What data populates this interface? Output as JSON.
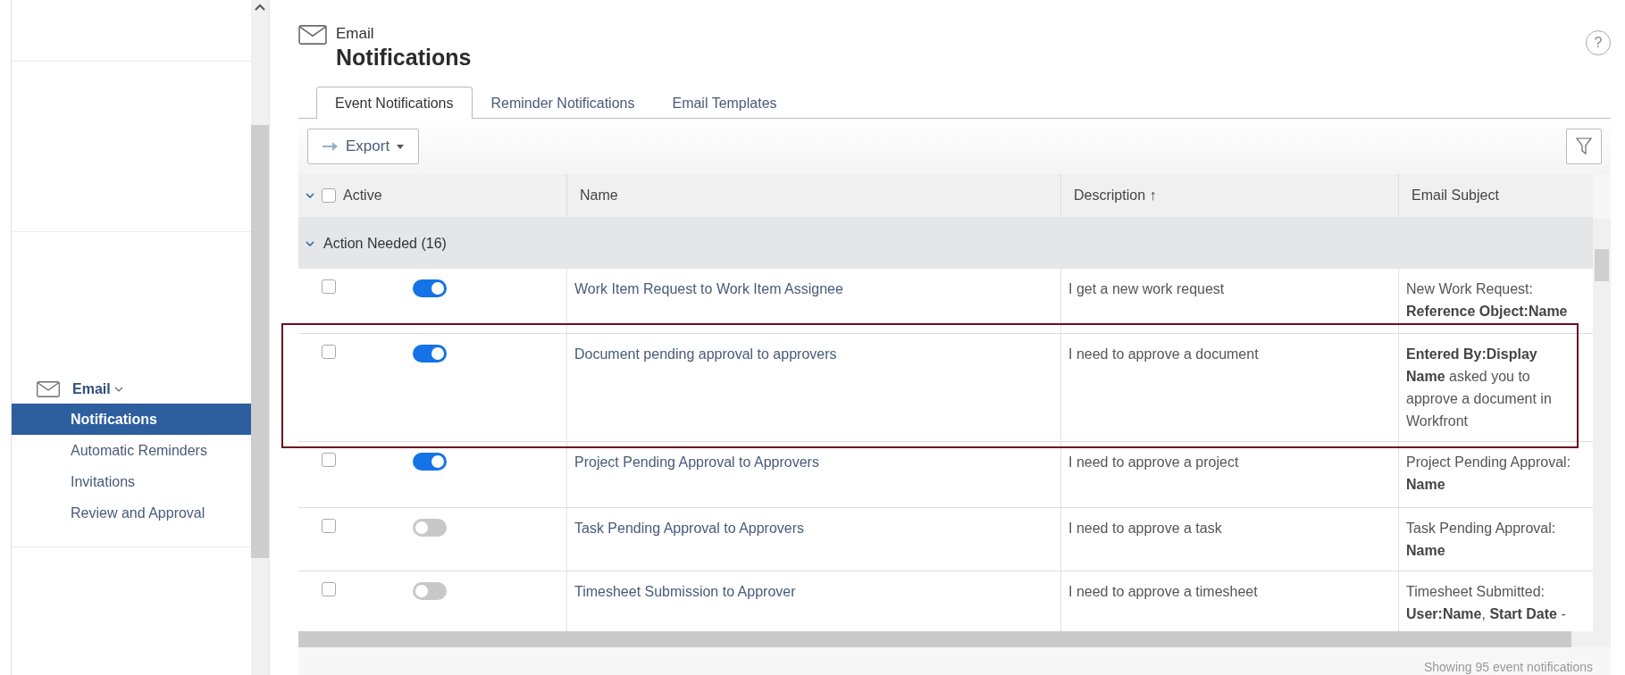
{
  "sidebar": {
    "section": {
      "label": "Email",
      "expanded": true
    },
    "items": [
      {
        "label": "Notifications",
        "selected": true
      },
      {
        "label": "Automatic Reminders",
        "selected": false
      },
      {
        "label": "Invitations",
        "selected": false
      },
      {
        "label": "Review and Approval",
        "selected": false
      }
    ]
  },
  "header": {
    "category": "Email",
    "title": "Notifications",
    "help": "?"
  },
  "tabs": [
    {
      "label": "Event Notifications",
      "selected": true
    },
    {
      "label": "Reminder Notifications",
      "selected": false
    },
    {
      "label": "Email Templates",
      "selected": false
    }
  ],
  "toolbar": {
    "export_button": "Export"
  },
  "table": {
    "columns": [
      "Active",
      "Name",
      "Description ↑",
      "Email Subject"
    ],
    "select_all_checked": false,
    "group": {
      "label": "Action Needed (16)",
      "expanded": true
    },
    "rows": [
      {
        "checked": false,
        "on": true,
        "name": "Work Item Request to Work Item Assignee",
        "description": "I get a new work request",
        "email_subject": "New Work Request: **Reference Object:Name**"
      },
      {
        "checked": false,
        "on": true,
        "name": "Document pending approval to approvers",
        "description": "I need to approve a document",
        "email_subject": "**Entered By:Display Name** asked you to approve a document in Workfront"
      },
      {
        "checked": false,
        "on": true,
        "name": "Project Pending Approval to Approvers",
        "description": "I need to approve a project",
        "email_subject": "Project Pending Approval: **Name**"
      },
      {
        "checked": false,
        "on": false,
        "name": "Task Pending Approval to Approvers",
        "description": "I need to approve a task",
        "email_subject": "Task Pending Approval: **Name**"
      },
      {
        "checked": false,
        "on": false,
        "name": "Timesheet Submission to Approver",
        "description": "I need to approve a timesheet",
        "email_subject": "Timesheet Submitted: **User:Name**, **Start Date** -"
      }
    ]
  },
  "footer": "Showing 95 event notifications"
}
